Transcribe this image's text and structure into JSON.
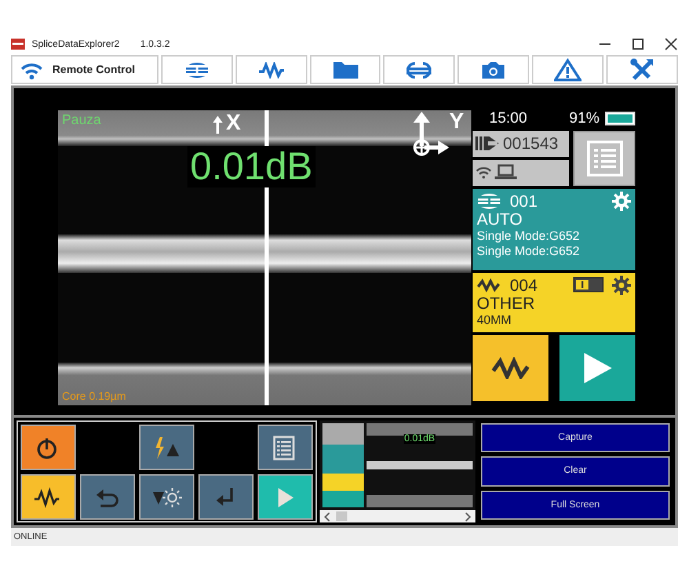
{
  "window": {
    "title": "SpliceDataExplorer2",
    "version": "1.0.3.2"
  },
  "toolbar": [
    {
      "kind": "remote",
      "label": "Remote Control"
    },
    {
      "kind": "splice"
    },
    {
      "kind": "wave"
    },
    {
      "kind": "folder"
    },
    {
      "kind": "fiber"
    },
    {
      "kind": "camera"
    },
    {
      "kind": "warning"
    },
    {
      "kind": "tools"
    }
  ],
  "viewer": {
    "status": "Pauza",
    "x_label": "X",
    "y_label": "Y",
    "loss": "0.01dB",
    "core": "Core 0.19µm"
  },
  "device": {
    "time": "15:00",
    "battery": "91%",
    "counter": "001543"
  },
  "splice_program": {
    "number": "001",
    "mode": "AUTO",
    "fiber_left": "Single Mode:G652",
    "fiber_right": "Single Mode:G652"
  },
  "heater_program": {
    "number": "004",
    "name": "OTHER",
    "sleeve": "40MM"
  },
  "controls": [
    [
      {
        "kind": "power"
      },
      {
        "kind": "blank"
      },
      {
        "kind": "arc-up"
      },
      {
        "kind": "blank"
      },
      {
        "kind": "list"
      }
    ],
    [
      {
        "kind": "wave"
      },
      {
        "kind": "back"
      },
      {
        "kind": "dim"
      },
      {
        "kind": "enter"
      },
      {
        "kind": "play"
      }
    ]
  ],
  "thumbnail": {
    "loss": "0.01dB"
  },
  "actions": [
    "Capture",
    "Clear",
    "Full Screen"
  ],
  "status_bar": "ONLINE"
}
